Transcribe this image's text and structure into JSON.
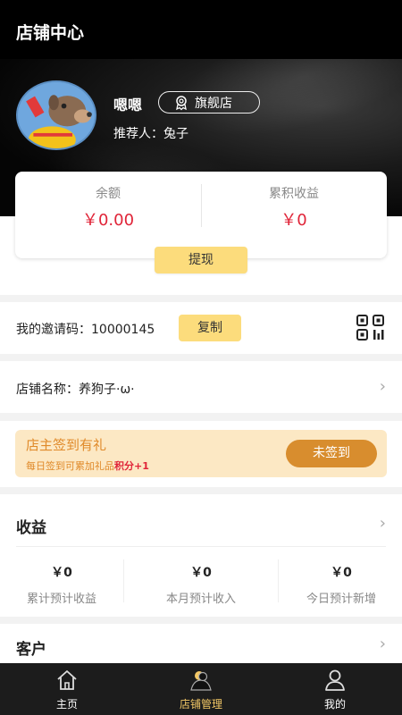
{
  "header": {
    "title": "店铺中心"
  },
  "profile": {
    "name": "嗯嗯",
    "badge": "旗舰店",
    "referrer": "推荐人：兔子"
  },
  "balance": {
    "balance_label": "余额",
    "balance_value": "￥0.00",
    "total_label": "累积收益",
    "total_value": "￥0",
    "withdraw_label": "提现"
  },
  "invite": {
    "label": "我的邀请码：10000145",
    "copy_label": "复制"
  },
  "shop": {
    "label": "店铺名称：养狗子·ω·"
  },
  "signin": {
    "title": "店主签到有礼",
    "desc_prefix": "每日签到可累加礼品",
    "desc_highlight": "积分+1",
    "button": "未签到"
  },
  "earnings": {
    "title": "收益",
    "stats": [
      {
        "value": "￥0",
        "label": "累计预计收益"
      },
      {
        "value": "￥0",
        "label": "本月预计收入"
      },
      {
        "value": "￥0",
        "label": "今日预计新增"
      }
    ]
  },
  "customers": {
    "title": "客户"
  },
  "tabs": [
    {
      "label": "主页",
      "icon": "home-icon"
    },
    {
      "label": "店铺管理",
      "icon": "shop-manage-icon"
    },
    {
      "label": "我的",
      "icon": "user-icon"
    }
  ],
  "colors": {
    "accent_yellow": "#fcdc7c",
    "price_red": "#e02438",
    "signin_orange": "#d88d2e",
    "tab_active": "#f3c866"
  }
}
